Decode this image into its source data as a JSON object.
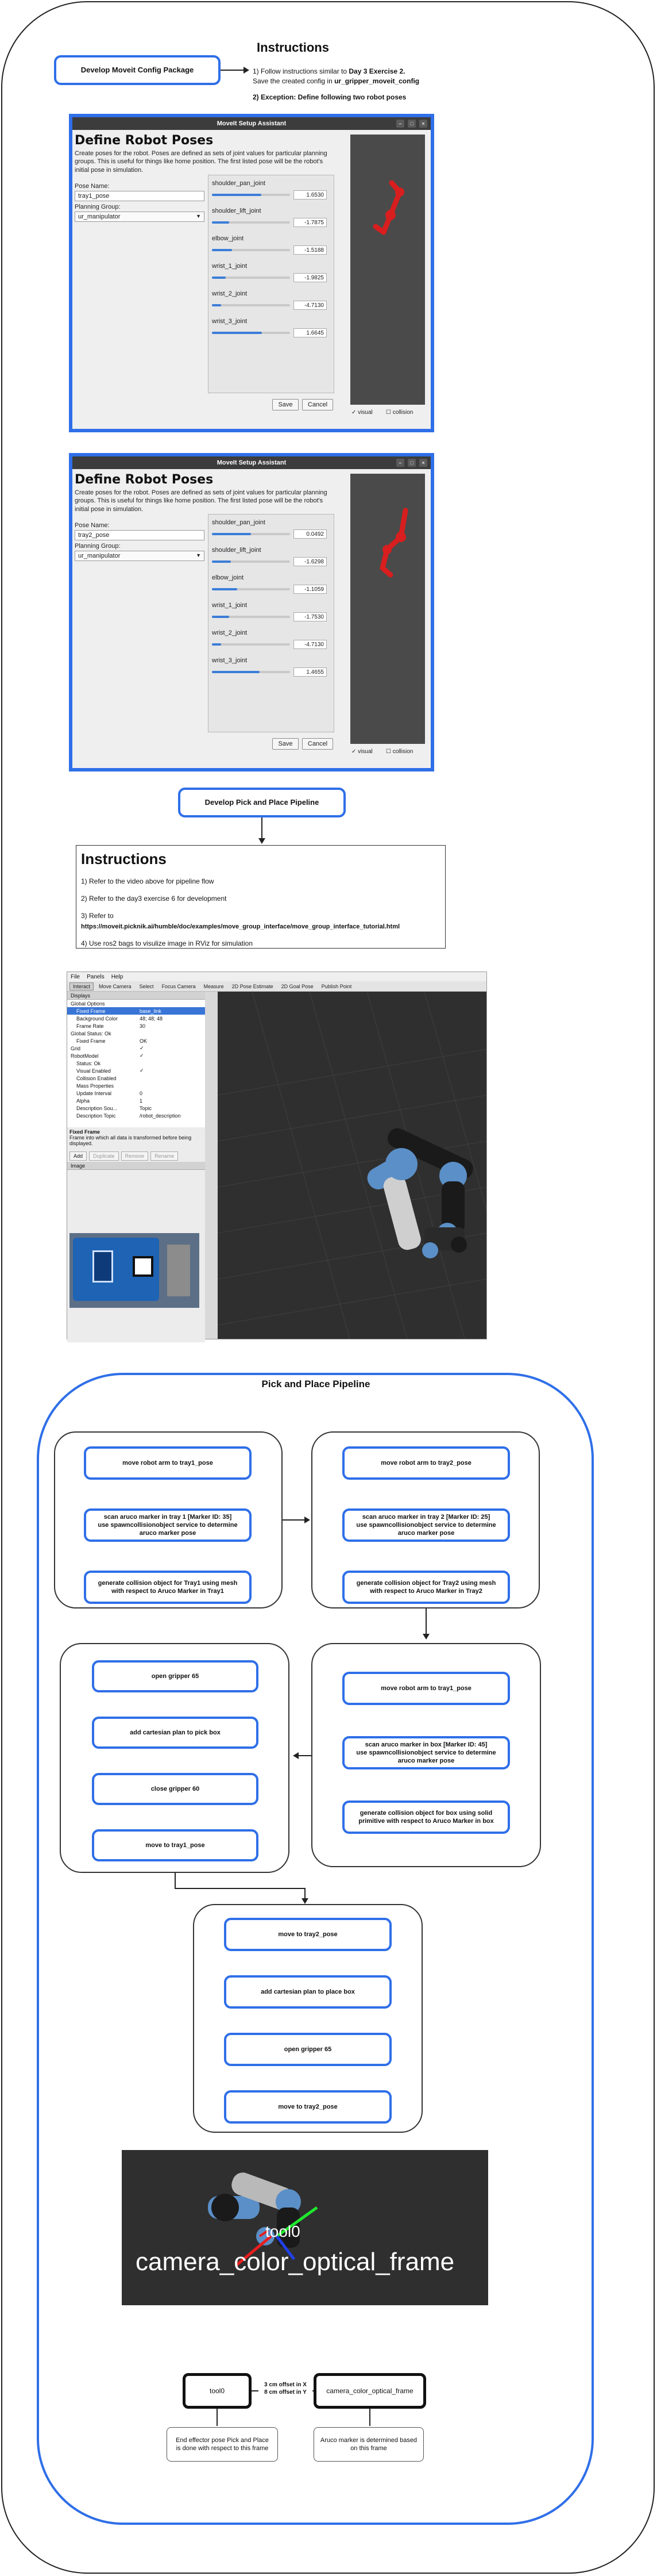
{
  "header": {
    "title": "Instructions",
    "develop_moveit": "Develop Moveit Config Package",
    "note1_prefix": "1) Follow instructions similar to ",
    "note1_bold": "Day 3 Exercise 2.",
    "note1_line2_prefix": "Save the created config in ",
    "note1_line2_bold": "ur_gripper_moveit_config",
    "note2": "2) Exception: Define following two robot poses"
  },
  "moveit_windows": [
    {
      "window_title": "MoveIt Setup Assistant",
      "heading": "Define Robot Poses",
      "description": "Create poses for the robot. Poses are defined as sets of joint values for particular planning groups. This is useful for things like home position. The first listed pose will be the robot's initial pose in simulation.",
      "pose_name_label": "Pose Name:",
      "pose_name_value": "tray1_pose",
      "planning_group_label": "Planning Group:",
      "planning_group_value": "ur_manipulator",
      "joints": [
        {
          "name": "shoulder_pan_joint",
          "value": "1.6530",
          "fill": 0.63
        },
        {
          "name": "shoulder_lift_joint",
          "value": "-1.7875",
          "fill": 0.22
        },
        {
          "name": "elbow_joint",
          "value": "-1.5188",
          "fill": 0.26
        },
        {
          "name": "wrist_1_joint",
          "value": "-1.9825",
          "fill": 0.18
        },
        {
          "name": "wrist_2_joint",
          "value": "-4.7130",
          "fill": 0.12
        },
        {
          "name": "wrist_3_joint",
          "value": "1.6645",
          "fill": 0.64
        }
      ],
      "save": "Save",
      "cancel": "Cancel",
      "visual": "visual",
      "collision": "collision"
    },
    {
      "window_title": "MoveIt Setup Assistant",
      "heading": "Define Robot Poses",
      "description": "Create poses for the robot. Poses are defined as sets of joint values for particular planning groups. This is useful for things like home position. The first listed pose will be the robot's initial pose in simulation.",
      "pose_name_label": "Pose Name:",
      "pose_name_value": "tray2_pose",
      "planning_group_label": "Planning Group:",
      "planning_group_value": "ur_manipulator",
      "joints": [
        {
          "name": "shoulder_pan_joint",
          "value": "0.0492",
          "fill": 0.5
        },
        {
          "name": "shoulder_lift_joint",
          "value": "-1.6298",
          "fill": 0.24
        },
        {
          "name": "elbow_joint",
          "value": "-1.1059",
          "fill": 0.32
        },
        {
          "name": "wrist_1_joint",
          "value": "-1.7530",
          "fill": 0.22
        },
        {
          "name": "wrist_2_joint",
          "value": "-4.7130",
          "fill": 0.12
        },
        {
          "name": "wrist_3_joint",
          "value": "1.4655",
          "fill": 0.61
        }
      ],
      "save": "Save",
      "cancel": "Cancel",
      "visual": "visual",
      "collision": "collision"
    }
  ],
  "develop_pick_place": "Develop Pick and Place Pipeline",
  "instructions_panel": {
    "title": "Instructions",
    "line1": "1) Refer to the video above for pipeline flow",
    "line2": "2) Refer to the day3 exercise 6 for development",
    "line3": "3) Refer to",
    "link": "https://moveit.picknik.ai/humble/doc/examples/move_group_interface/move_group_interface_tutorial.html",
    "line4": "4) Use ros2 bags to visulize image in RViz for simulation"
  },
  "rviz": {
    "menu": [
      "File",
      "Panels",
      "Help"
    ],
    "tools": [
      "Interact",
      "Move Camera",
      "Select",
      "Focus Camera",
      "Measure",
      "2D Pose Estimate",
      "2D Goal Pose",
      "Publish Point"
    ],
    "displays_title": "Displays",
    "tree": [
      {
        "indent": 0,
        "label": "Global Options",
        "value": "",
        "selected": false
      },
      {
        "indent": 1,
        "label": "Fixed Frame",
        "value": "base_link",
        "selected": true
      },
      {
        "indent": 1,
        "label": "Background Color",
        "value": "48; 48; 48",
        "selected": false
      },
      {
        "indent": 1,
        "label": "Frame Rate",
        "value": "30",
        "selected": false
      },
      {
        "indent": 0,
        "label": "Global Status: Ok",
        "value": "",
        "selected": false
      },
      {
        "indent": 1,
        "label": "Fixed Frame",
        "value": "OK",
        "selected": false
      },
      {
        "indent": 0,
        "label": "Grid",
        "value": "✓",
        "selected": false
      },
      {
        "indent": 0,
        "label": "RobotModel",
        "value": "✓",
        "selected": false
      },
      {
        "indent": 1,
        "label": "Status: Ok",
        "value": "",
        "selected": false
      },
      {
        "indent": 1,
        "label": "Visual Enabled",
        "value": "✓",
        "selected": false
      },
      {
        "indent": 1,
        "label": "Collision Enabled",
        "value": "",
        "selected": false
      },
      {
        "indent": 1,
        "label": "Mass Properties",
        "value": "",
        "selected": false
      },
      {
        "indent": 1,
        "label": "Update Interval",
        "value": "0",
        "selected": false
      },
      {
        "indent": 1,
        "label": "Alpha",
        "value": "1",
        "selected": false
      },
      {
        "indent": 1,
        "label": "Description Sou...",
        "value": "Topic",
        "selected": false
      },
      {
        "indent": 1,
        "label": "Description Topic",
        "value": "/robot_description",
        "selected": false
      }
    ],
    "fixed_frame_title": "Fixed Frame",
    "fixed_frame_desc": "Frame into which all data is transformed before being displayed.",
    "buttons": [
      "Add",
      "Duplicate",
      "Remove",
      "Rename"
    ],
    "image_title": "Image"
  },
  "pipeline": {
    "title": "Pick and Place Pipeline",
    "tray1": [
      "move robot arm to tray1_pose",
      "scan aruco marker in tray 1 [Marker ID: 35]\nuse spawncollisionobject service to determine\naruco marker pose",
      "generate collision object for Tray1 using mesh\nwith respect to Aruco Marker in Tray1"
    ],
    "tray2": [
      "move robot arm to tray2_pose",
      "scan aruco marker in tray 2 [Marker ID: 25]\nuse spawncollisionobject service to determine\naruco marker pose",
      "generate collision object for Tray2 using mesh\nwith respect to Aruco Marker in Tray2"
    ],
    "box": [
      "move robot arm to tray1_pose",
      "scan aruco marker in box [Marker ID: 45]\nuse spawncollisionobject service to determine\naruco marker pose",
      "generate collision object for box using solid\nprimitive with respect to Aruco Marker in box"
    ],
    "pick": [
      "open gripper 65",
      "add cartesian plan to pick box",
      "close gripper 60",
      "move to tray1_pose"
    ],
    "place": [
      "move to tray2_pose",
      "add cartesian plan to place box",
      "open gripper 65",
      "move to tray2_pose"
    ],
    "frame_label": "camera_color_optical_frame",
    "tool0_label": "tool0",
    "tf_left": "tool0",
    "tf_offset": "3 cm offset in X\n8 cm offset in Y",
    "tf_right": "camera_color_optical_frame",
    "tf_note_left": "End effector pose Pick and Place\nis done with respect to this frame",
    "tf_note_right": "Aruco marker is determined based\non this frame"
  },
  "colors": {
    "accent": "#2f6fe8",
    "robot_red": "#d81e1e",
    "ur_blue": "#5b8fc7"
  }
}
